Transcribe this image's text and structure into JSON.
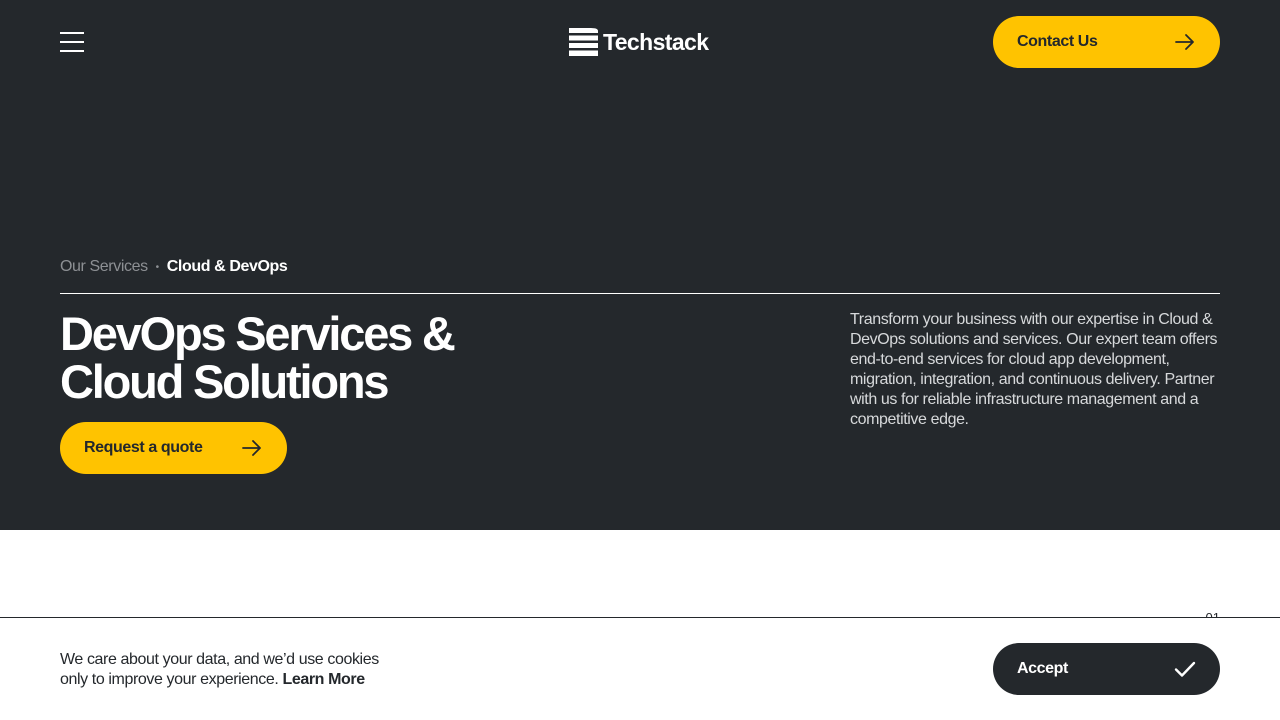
{
  "header": {
    "menu_icon": "hamburger-menu-icon",
    "logo_text": "Techstack",
    "contact_label": "Contact Us",
    "contact_icon": "arrow-right-icon"
  },
  "breadcrumb": {
    "parent": "Our Services",
    "separator": "•",
    "current": "Cloud & DevOps"
  },
  "hero": {
    "title": "DevOps Services & Cloud Solutions",
    "description": "Transform your business with our expertise in Cloud & DevOps solutions and services. Our expert team offers end-to-end services for cloud app development, migration, integration, and continuous delivery. Partner with us for reliable infrastructure management and a competitive edge.",
    "cta_label": "Request a quote",
    "cta_icon": "arrow-right-icon"
  },
  "section": {
    "index": "01"
  },
  "cookie": {
    "text": "We care about your data, and we’d use cookies only to improve your experience.",
    "link_label": "Learn More",
    "accept_label": "Accept",
    "accept_icon": "checkmark-icon"
  },
  "colors": {
    "dark": "#24282c",
    "accent": "#ffc300",
    "muted": "#8d9094"
  }
}
